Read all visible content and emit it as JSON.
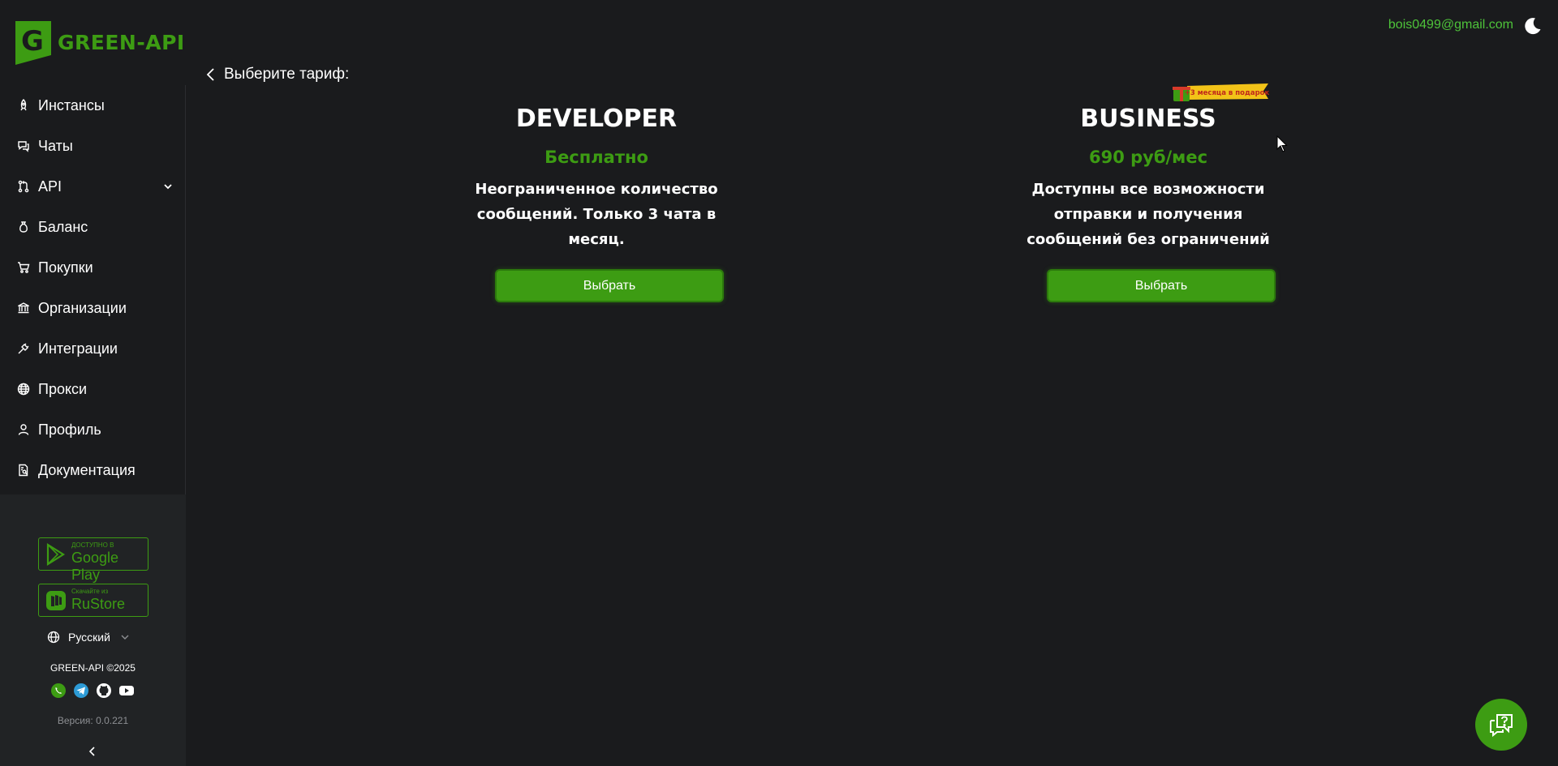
{
  "brand": {
    "name": "GREEN-API",
    "accent": "#3d9c13"
  },
  "sidebar": {
    "items": [
      {
        "label": "Инстансы",
        "icon": "rocket-icon"
      },
      {
        "label": "Чаты",
        "icon": "chat-icon"
      },
      {
        "label": "API",
        "icon": "git-branch-icon",
        "has_dropdown": true
      },
      {
        "label": "Баланс",
        "icon": "money-bag-icon"
      },
      {
        "label": "Покупки",
        "icon": "cart-icon"
      },
      {
        "label": "Организации",
        "icon": "bank-icon"
      },
      {
        "label": "Интеграции",
        "icon": "plug-icon"
      },
      {
        "label": "Прокси",
        "icon": "globe-icon"
      },
      {
        "label": "Профиль",
        "icon": "user-icon"
      },
      {
        "label": "Документация",
        "icon": "document-search-icon"
      }
    ],
    "stores": [
      {
        "small": "ДОСТУПНО В",
        "big": "Google Play",
        "icon": "google-play-icon"
      },
      {
        "small": "Скачайте из",
        "big": "RuStore",
        "icon": "rustore-icon"
      }
    ],
    "language": "Русский",
    "copyright": "GREEN-API ©2025",
    "socials": [
      "whatsapp-icon",
      "telegram-icon",
      "github-icon",
      "youtube-icon"
    ],
    "version": "Версия: 0.0.221"
  },
  "header": {
    "email": "bois0499@gmail.com"
  },
  "page": {
    "back_label": "Выберите тариф:"
  },
  "plans": [
    {
      "name": "DEVELOPER",
      "price": "Бесплатно",
      "description": "Неограниченное количество сообщений. Только 3 чата в месяц.",
      "button": "Выбрать"
    },
    {
      "name": "BUSINESS",
      "price": "690 руб/мес",
      "description": "Доступны все возможности отправки и получения сообщений без ограничений",
      "button": "Выбрать",
      "badge": "+3 месяца в подарок"
    }
  ]
}
